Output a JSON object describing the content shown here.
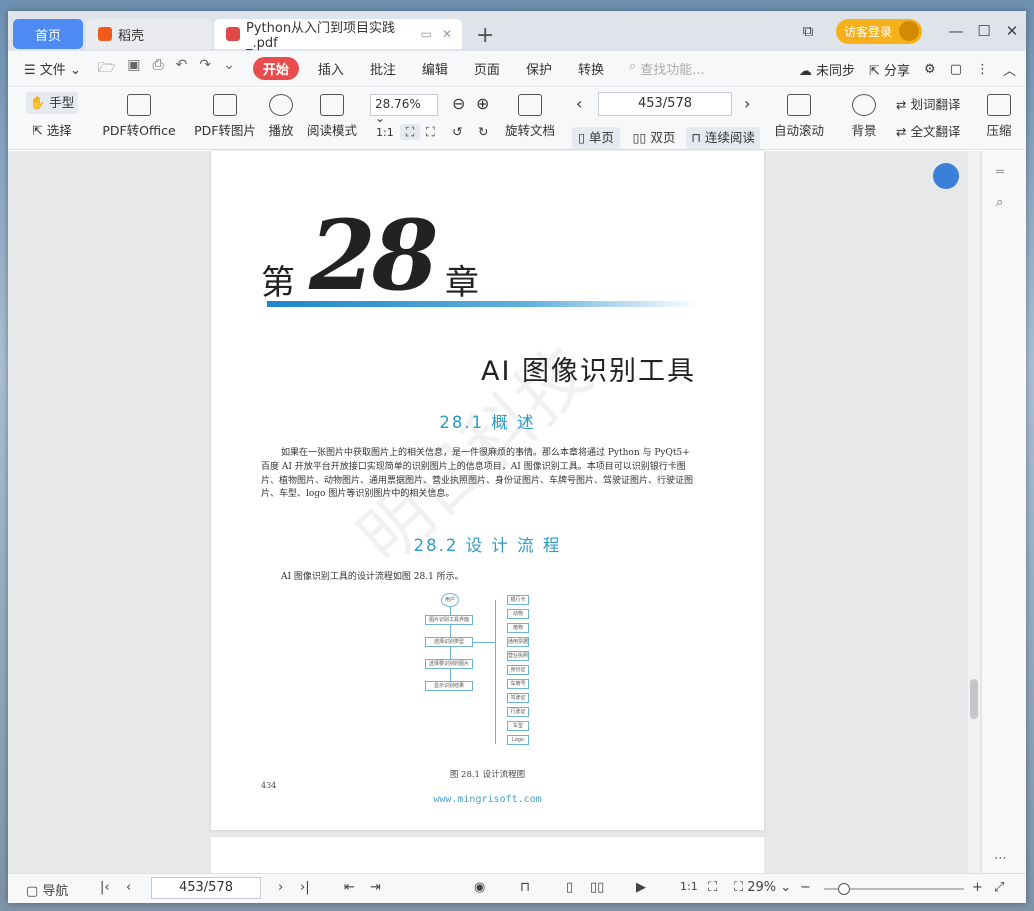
{
  "tabs": {
    "home": "首页",
    "daoke": "稻壳",
    "doc": "Python从入门到项目实践_.pdf"
  },
  "titlebar": {
    "login": "访客登录"
  },
  "menubar": {
    "file": "文件",
    "items": [
      "开始",
      "插入",
      "批注",
      "编辑",
      "页面",
      "保护",
      "转换"
    ],
    "search_placeholder": "查找功能...",
    "sync": "未同步",
    "share": "分享"
  },
  "toolbar": {
    "hand": "手型",
    "select": "选择",
    "pdf_to_office": "PDF转Office",
    "pdf_to_image": "PDF转图片",
    "play": "播放",
    "read_mode": "阅读模式",
    "zoom": "28.76%",
    "rotate": "旋转文档",
    "page": "453/578",
    "single": "单页",
    "double": "双页",
    "continuous": "连续阅读",
    "auto_scroll": "自动滚动",
    "background": "背景",
    "word_translate": "划词翻译",
    "full_translate": "全文翻译",
    "compress": "压缩"
  },
  "document": {
    "chapter_prefix": "第",
    "chapter_num": "28",
    "chapter_suffix": "章",
    "chapter_title": "AI 图像识别工具",
    "section1": "28.1 概 述",
    "para1": "如果在一张图片中获取图片上的相关信息，是一件很麻烦的事情。那么本章将通过 Python 与 PyQt5+ 百度 AI 开放平台开放接口实现简单的识别图片上的信息项目，AI 图像识别工具。本项目可以识别银行卡图片、植物图片、动物图片、通用票据图片、营业执照图片、身份证图片、车牌号图片、驾驶证图片、行驶证图片、车型、logo 图片等识别图片中的相关信息。",
    "section2": "28.2 设 计 流 程",
    "para2": "AI 图像识别工具的设计流程如图 28.1 所示。",
    "figure_caption": "图 28.1 设计流程图",
    "page_number": "434",
    "url": "www.mingrisoft.com",
    "watermark": "明日科技",
    "flow_left": [
      "用户",
      "图片识别工具界面",
      "选择识别类型",
      "选择要识别的图片",
      "显示识别结果"
    ],
    "flow_right": [
      "银行卡",
      "动物",
      "植物",
      "通用票据",
      "营业执照",
      "身份证",
      "车牌号",
      "驾驶证",
      "行驶证",
      "车型",
      "Logo"
    ]
  },
  "statusbar": {
    "nav": "导航",
    "page": "453/578",
    "zoom": "29%"
  }
}
